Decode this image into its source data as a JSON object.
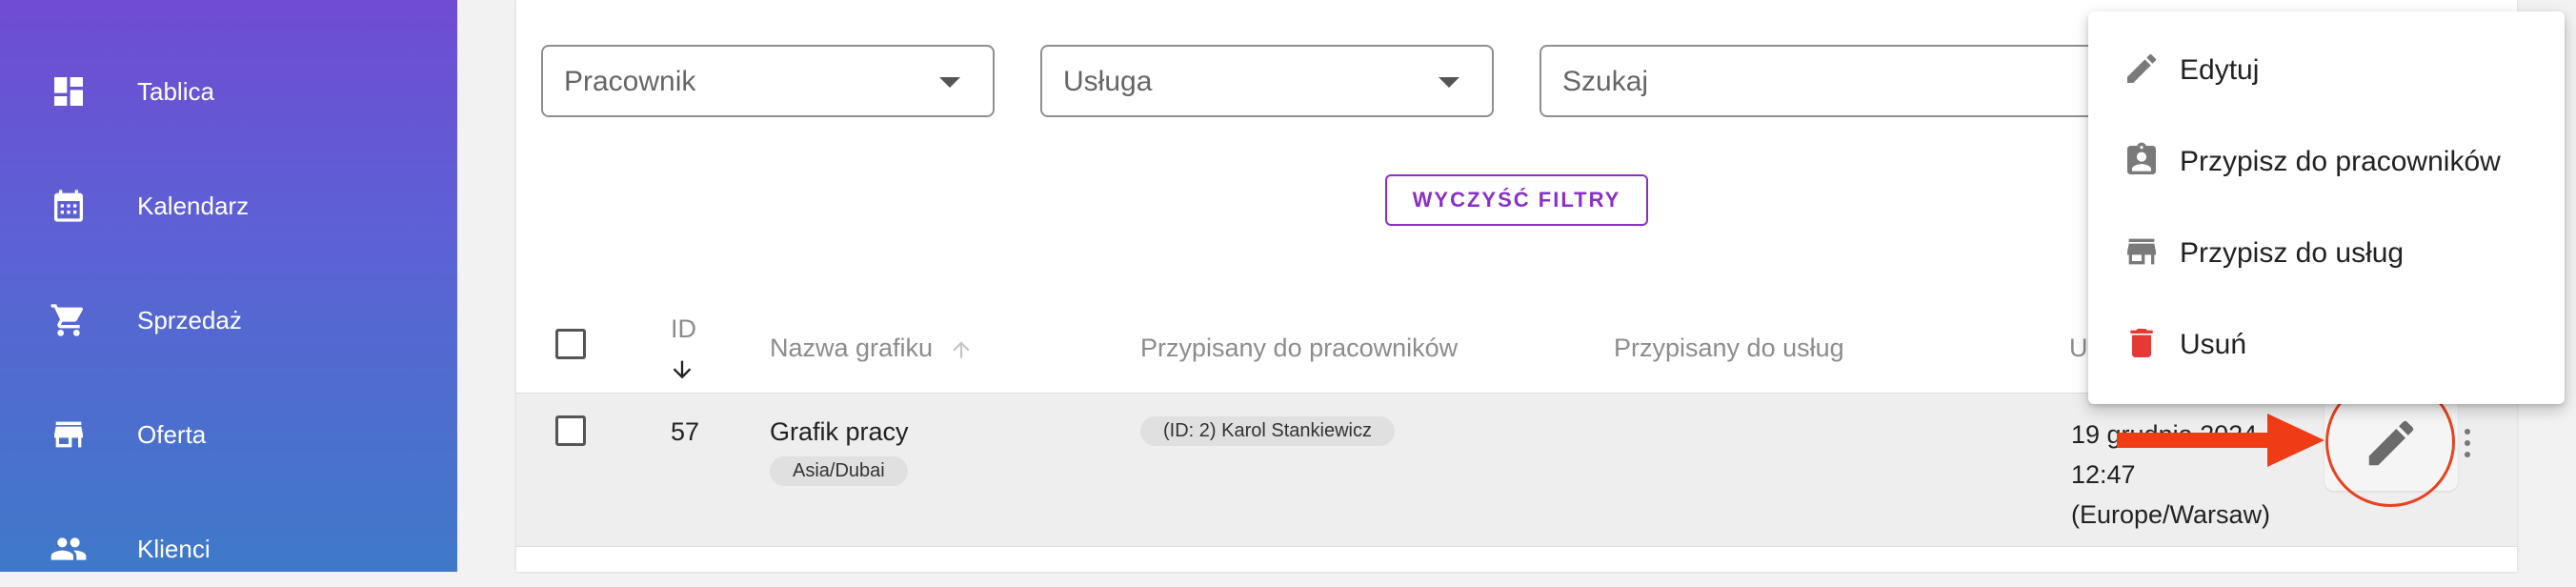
{
  "sidebar": {
    "items": [
      {
        "label": "Tablica",
        "icon": "dashboard-icon"
      },
      {
        "label": "Kalendarz",
        "icon": "calendar-icon"
      },
      {
        "label": "Sprzedaż",
        "icon": "cart-icon"
      },
      {
        "label": "Oferta",
        "icon": "store-icon"
      },
      {
        "label": "Klienci",
        "icon": "people-icon"
      }
    ]
  },
  "filters": {
    "employee_placeholder": "Pracownik",
    "service_placeholder": "Usługa",
    "search_placeholder": "Szukaj",
    "clear_label": "WYCZYŚĆ FILTRY"
  },
  "table": {
    "headers": {
      "id": "ID",
      "name": "Nazwa grafiku",
      "employees": "Przypisany do pracowników",
      "services": "Przypisany do usług",
      "updated": "U"
    },
    "rows": [
      {
        "id": "57",
        "name": "Grafik pracy",
        "timezone": "Asia/Dubai",
        "employee_chip": "(ID: 2) Karol Stankiewicz",
        "date_line1": "19 grudnia 2024",
        "date_line2": "12:47",
        "date_line3": "(Europe/Warsaw)"
      }
    ]
  },
  "menu": {
    "items": [
      {
        "label": "Edytuj",
        "icon": "pencil-icon"
      },
      {
        "label": "Przypisz do pracowników",
        "icon": "assign-employee-icon"
      },
      {
        "label": "Przypisz do usług",
        "icon": "store-icon"
      },
      {
        "label": "Usuń",
        "icon": "trash-icon"
      }
    ]
  },
  "colors": {
    "accent": "#8a2fc9",
    "delete": "#e53935",
    "highlight": "#e8421e"
  }
}
